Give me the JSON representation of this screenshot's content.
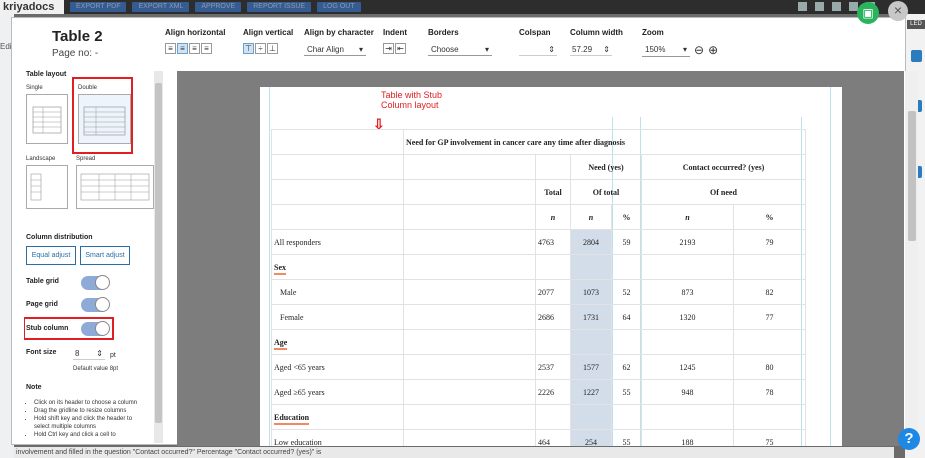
{
  "app": {
    "logo": "kriyadocs",
    "top_buttons": [
      "EXPORT PDF",
      "EXPORT XML",
      "APPROVE",
      "REPORT ISSUE",
      "LOG OUT"
    ],
    "left_label": "Edit",
    "right_badge": "LED",
    "status_text": "involvement and filled in the question \"Contact occurred?\" Percentage \"Contact occurred? (yes)\" is"
  },
  "dialog": {
    "title": "Table 2",
    "page_no": "Page no: -",
    "close_icon": "×"
  },
  "toolbar": {
    "align_horizontal_label": "Align horizontal",
    "align_vertical_label": "Align vertical",
    "align_by_character_label": "Align by character",
    "align_by_character_value": "Char Align",
    "indent_label": "Indent",
    "borders_label": "Borders",
    "borders_value": "Choose",
    "colspan_label": "Colspan",
    "colspan_value": "",
    "column_width_label": "Column width",
    "column_width_value": "57.29",
    "zoom_label": "Zoom",
    "zoom_value": "150%"
  },
  "left_panel": {
    "table_layout_label": "Table layout",
    "layouts": [
      "Single",
      "Double",
      "Landscape",
      "Spread"
    ],
    "column_distribution_label": "Column distribution",
    "equal_adjust_label": "Equal adjust",
    "smart_adjust_label": "Smart adjust",
    "table_grid_label": "Table grid",
    "page_grid_label": "Page grid",
    "stub_column_label": "Stub column",
    "font_size_label": "Font size",
    "font_size_value": "8",
    "font_size_unit": "pt",
    "font_default": "Default value 8pt",
    "note_label": "Note",
    "notes": [
      "Click on its header to choose a column",
      "Drag the gridline to resize columns",
      "Hold shift key and click the header to select multiple columns",
      "Hold Ctrl key and click a cell to"
    ]
  },
  "canvas": {
    "annotation": "Table with Stub Column layout",
    "arrow": "⇩",
    "table": {
      "caption": "Need for GP involvement in cancer care any time after diagnosis",
      "header_need": "Need (yes)",
      "header_contact": "Contact occurred? (yes)",
      "header_total": "Total",
      "header_of_total": "Of total",
      "header_of_need": "Of need",
      "header_n": "n",
      "header_pct": "%",
      "rows": [
        {
          "label": "All responders",
          "total": "4763",
          "n": "2804",
          "pct": "59",
          "n2": "2193",
          "pct2": "79"
        },
        {
          "label": "Sex"
        },
        {
          "label": "Male",
          "total": "2077",
          "n": "1073",
          "pct": "52",
          "n2": "873",
          "pct2": "82"
        },
        {
          "label": "Female",
          "total": "2686",
          "n": "1731",
          "pct": "64",
          "n2": "1320",
          "pct2": "77"
        },
        {
          "label": "Age"
        },
        {
          "label": "Aged <65 years",
          "total": "2537",
          "n": "1577",
          "pct": "62",
          "n2": "1245",
          "pct2": "80"
        },
        {
          "label": "Aged ≥65 years",
          "total": "2226",
          "n": "1227",
          "pct": "55",
          "n2": "948",
          "pct2": "78"
        },
        {
          "label": "Education"
        },
        {
          "label": "Low education",
          "total": "464",
          "n": "254",
          "pct": "55",
          "n2": "188",
          "pct2": "75"
        }
      ]
    }
  }
}
